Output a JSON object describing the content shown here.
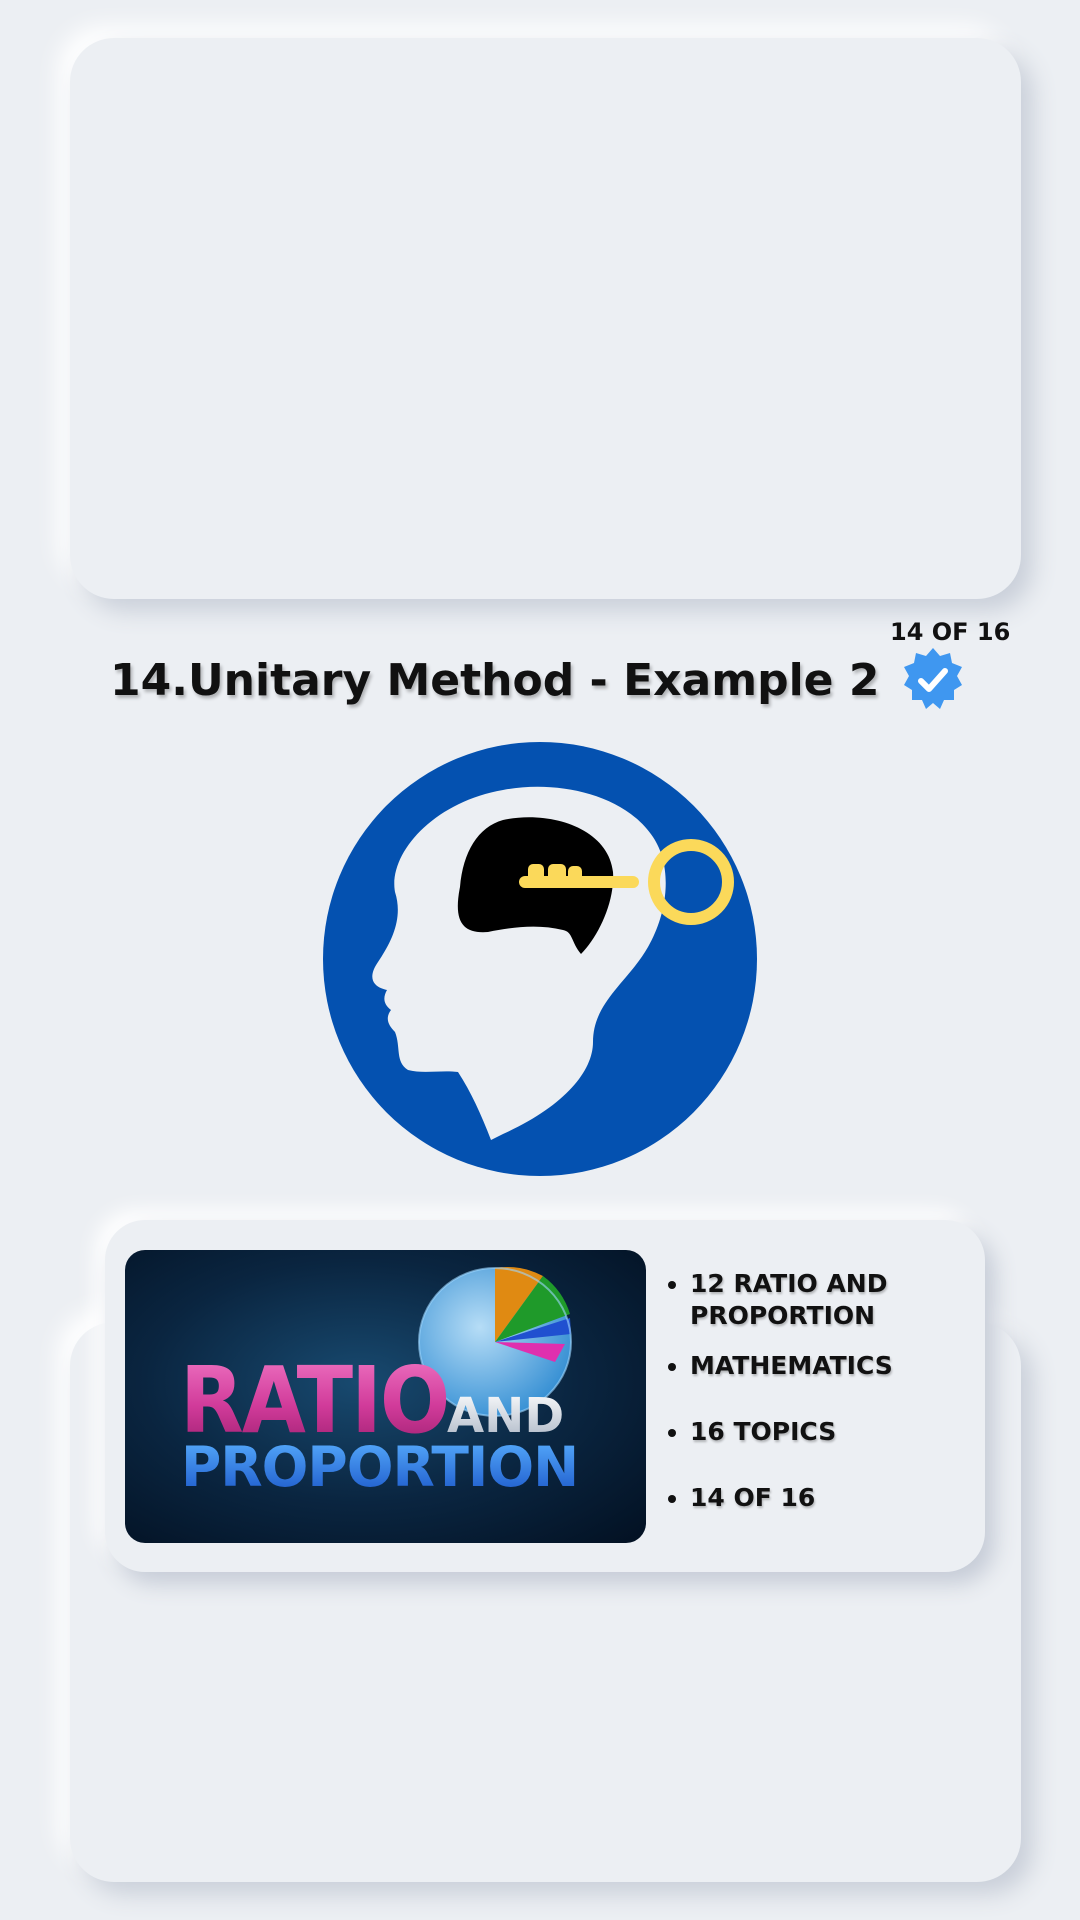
{
  "lesson": {
    "title": "14.Unitary Method - Example 2",
    "progress": "14 OF 16",
    "verified": true
  },
  "course": {
    "banner_text": {
      "word1": "RATIO",
      "word2": "AND",
      "word3": "PROPORTION"
    },
    "meta": [
      "12 RATIO AND PROPORTION",
      "MATHEMATICS",
      "16 TOPICS",
      "14 OF 16"
    ]
  },
  "icons": {
    "verified": "verified-badge-icon",
    "course": "head-key-icon"
  },
  "colors": {
    "background": "#eceff3",
    "icon_blue": "#0451b0",
    "key_yellow": "#fbd95a",
    "badge_blue": "#3f97f0"
  }
}
